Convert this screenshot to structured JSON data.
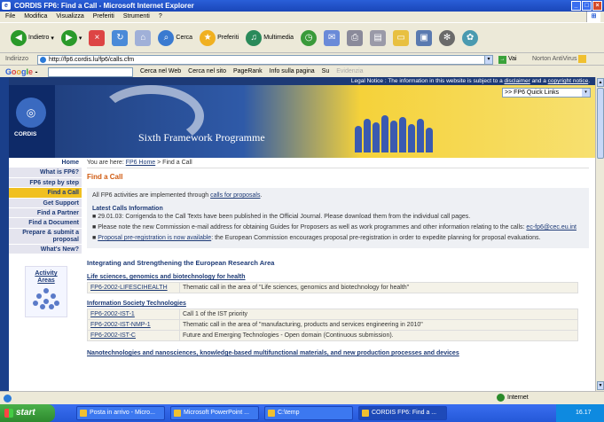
{
  "window": {
    "title": "CORDIS FP6: Find a Call - Microsoft Internet Explorer"
  },
  "menu": [
    "File",
    "Modifica",
    "Visualizza",
    "Preferiti",
    "Strumenti",
    "?"
  ],
  "toolbar": {
    "back": "Indietro",
    "search": "Cerca",
    "favorites": "Preferiti",
    "multimedia": "Multimedia"
  },
  "address": {
    "label": "Indirizzo",
    "url": "http://fp6.cordis.lu/fp6/calls.cfm",
    "go": "Vai",
    "antivirus": "Norton AntiVirus"
  },
  "google": {
    "logo": "Google -",
    "items": [
      "Cerca nel Web",
      "Cerca nel sito",
      "PageRank",
      "Info sulla pagina",
      "Su",
      "Evidenzia"
    ]
  },
  "page": {
    "legal_prefix": "Legal Notice : The information in this website is subject to a ",
    "legal_disclaimer": "disclaimer",
    "legal_mid": " and a ",
    "legal_copyright": "copyright notice",
    "legal_end": ".",
    "quicklinks": ">> FP6 Quick Links",
    "cordis": "CORDIS",
    "programme": "Sixth Framework Programme",
    "breadcrumb_prefix": "You are here: ",
    "breadcrumb_link": "FP6 Home",
    "breadcrumb_current": " > Find a Call",
    "sidebar": [
      "Home",
      "What is FP6?",
      "FP6 step by step",
      "Find a Call",
      "Get Support",
      "Find a Partner",
      "Find a Document",
      "Prepare & submit a proposal",
      "What's New?"
    ],
    "activity_areas": "Activity Areas",
    "title": "Find a Call",
    "intro_prefix": "All FP6 activities are implemented through ",
    "intro_link": "calls for proposals",
    "intro_end": ".",
    "latest_title": "Latest Calls Information",
    "news1": "29.01.03: Corrigenda to the Call Texts have been published in the Official Journal. Please download them from the individual call pages.",
    "news2_prefix": "Please note the new Commission e-mail address for obtaining Guides for Proposers as well as work programmes and other information relating to the calls: ",
    "news2_link": "ec-fp6@cec.eu.int",
    "news3_link": "Proposal pre-registration is now available",
    "news3_rest": ": the European Commission encourages proposal pre-registration in order to expedite planning for proposal evaluations.",
    "section": "Integrating and Strengthening the European Research Area",
    "groups": [
      {
        "title": "Life sciences, genomics and biotechnology for health",
        "rows": [
          {
            "code": "FP6-2002-LIFESCIHEALTH",
            "desc": "Thematic call in the area of \"Life sciences, genomics and biotechnology for health\""
          }
        ]
      },
      {
        "title": "Information Society Technologies",
        "rows": [
          {
            "code": "FP6-2002-IST-1",
            "desc": "Call 1 of the IST priority"
          },
          {
            "code": "FP6-2002-IST-NMP-1",
            "desc": "Thematic call in the area of \"manufacturing, products and services engineering in 2010\""
          },
          {
            "code": "FP6-2002-IST-C",
            "desc": "Future and Emerging Technologies - Open domain (Continuous submission)."
          }
        ]
      }
    ],
    "nano_title": "Nanotechnologies and nanosciences, knowledge-based multifunctional materials, and new production processes and devices"
  },
  "status": {
    "zone": "Internet"
  },
  "taskbar": {
    "start": "start",
    "tasks": [
      "Posta in arrivo - Micro...",
      "Microsoft PowerPoint ...",
      "C:\\temp",
      "CORDIS FP6: Find a ..."
    ],
    "clock": "16.17"
  }
}
